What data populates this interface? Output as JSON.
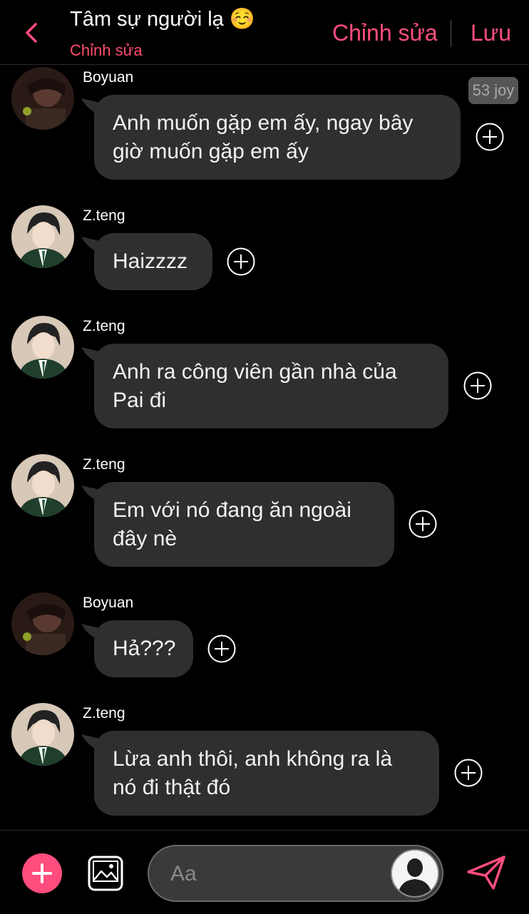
{
  "header": {
    "title": "Tâm sự người lạ ☺️",
    "subtitle": "Chỉnh sửa",
    "edit_label": "Chỉnh sửa",
    "save_label": "Lưu",
    "back_icon": "chevron-left-icon",
    "accent_color": "#ff4d7d"
  },
  "badge": "53 joy",
  "messages": [
    {
      "sender": "Boyuan",
      "text": "Anh muốn gặp em ấy, ngay bây giờ muốn gặp em ấy"
    },
    {
      "sender": "Z.teng",
      "text": "Haizzzz"
    },
    {
      "sender": "Z.teng",
      "text": "Anh ra công viên gần nhà của Pai đi"
    },
    {
      "sender": "Z.teng",
      "text": "Em với nó đang ăn ngoài đây nè"
    },
    {
      "sender": "Boyuan",
      "text": "Hả???"
    },
    {
      "sender": "Z.teng",
      "text": "Lừa anh thôi, anh không ra là nó đi thật đó"
    }
  ],
  "composer": {
    "placeholder": "Aa",
    "add_icon": "plus-icon",
    "image_icon": "image-icon",
    "send_icon": "send-icon"
  }
}
